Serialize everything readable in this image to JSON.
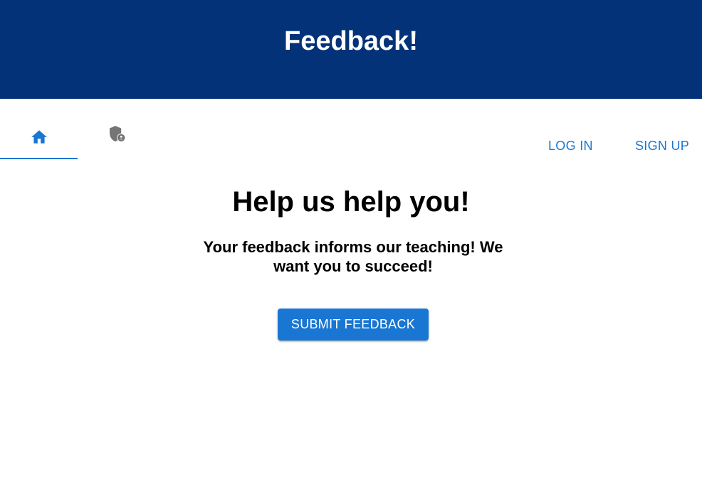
{
  "header": {
    "title": "Feedback!"
  },
  "tabs": [
    {
      "icon": "home-icon",
      "active": true
    },
    {
      "icon": "admin-shield-icon",
      "active": false
    }
  ],
  "nav": {
    "login_label": "LOG IN",
    "signup_label": "SIGN UP"
  },
  "hero": {
    "title": "Help us help you!",
    "subtitle": "Your feedback informs our teaching! We want you to succeed!",
    "button_label": "SUBMIT FEEDBACK"
  },
  "colors": {
    "header_bg": "#043278",
    "primary": "#1976d2",
    "icon_inactive": "#757575"
  }
}
